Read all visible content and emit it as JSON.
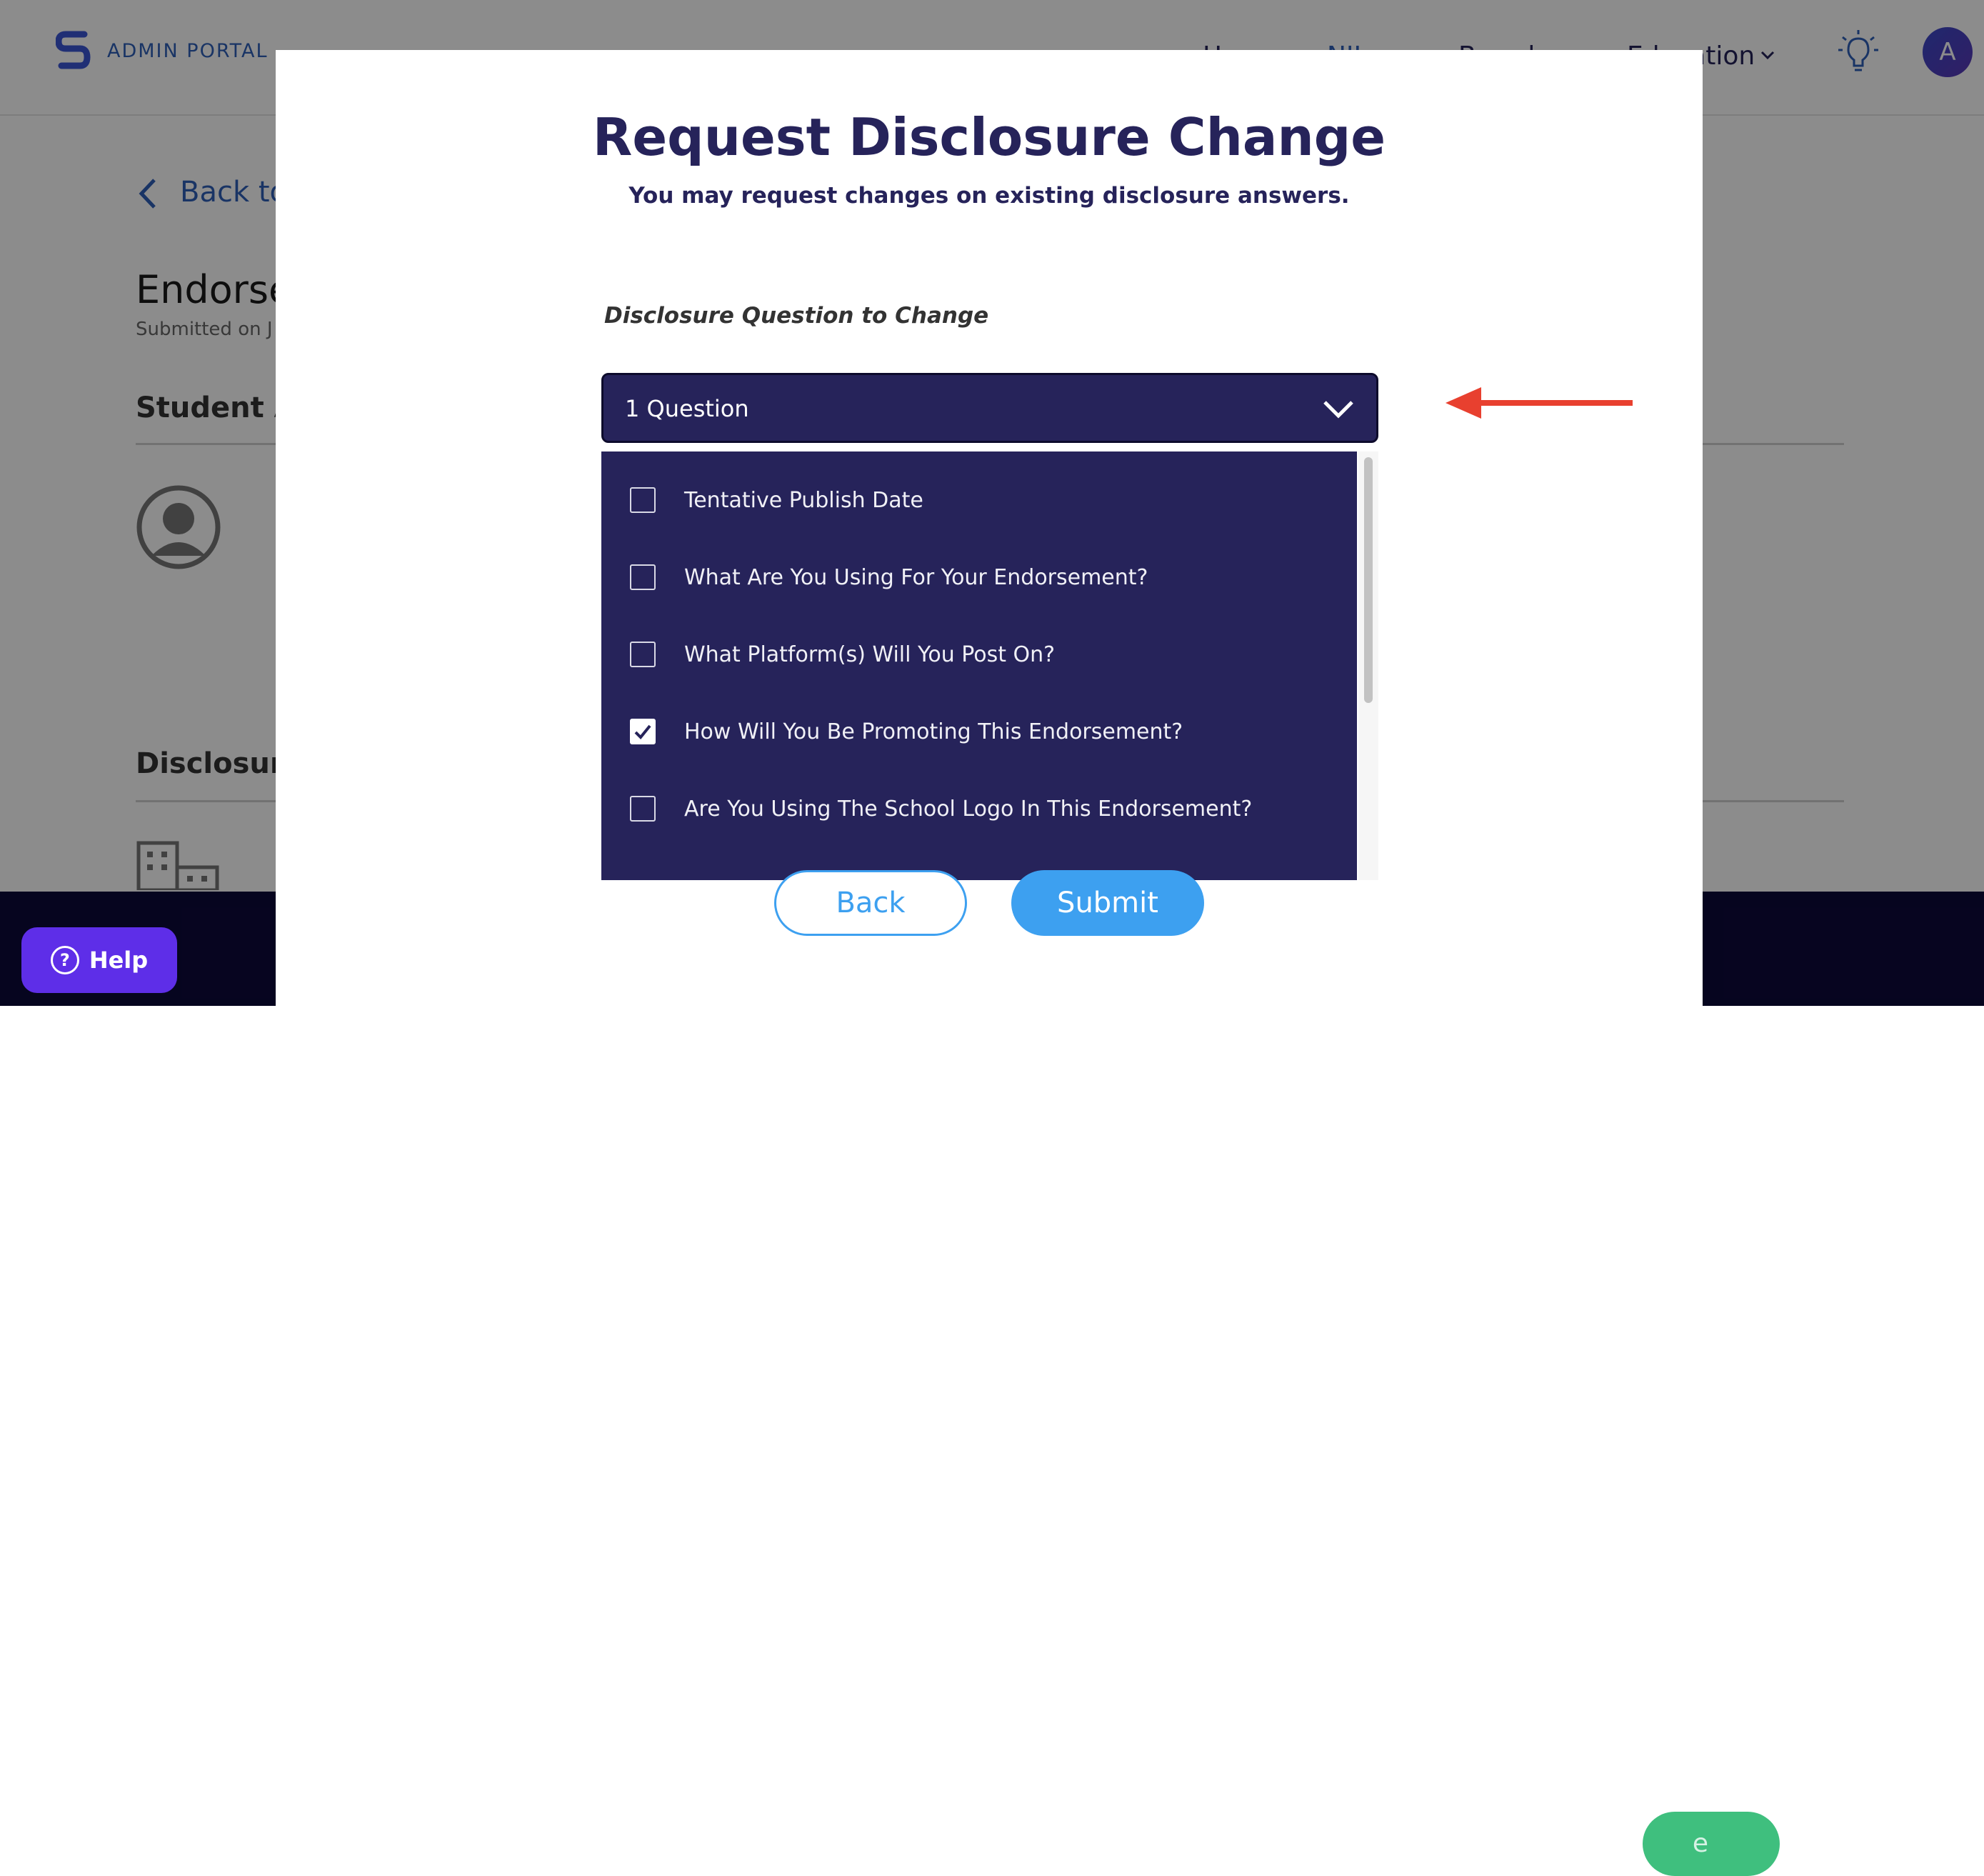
{
  "app": {
    "brand": "ADMIN PORTAL",
    "nav": [
      {
        "label": "Home"
      },
      {
        "label": "NIL"
      },
      {
        "label": "Brands"
      },
      {
        "label": "Education"
      }
    ],
    "avatar_initial": "A"
  },
  "page": {
    "back_label": "Back to",
    "title": "Endorse",
    "submitted": "Submitted on J",
    "section_student": "Student A",
    "section_disclosure": "Disclosure",
    "right_mark": "0"
  },
  "help": {
    "label": "Help",
    "icon": "question-icon"
  },
  "footer": {
    "cta_label": "e",
    "cta_color": "#3fbf7e"
  },
  "modal": {
    "title": "Request Disclosure Change",
    "subtitle": "You may request changes on existing disclosure answers.",
    "field_label": "Disclosure Question to Change",
    "select_value": "1 Question",
    "options": [
      {
        "label": "Tentative Publish Date",
        "checked": false
      },
      {
        "label": "What Are You Using For Your Endorsement?",
        "checked": false
      },
      {
        "label": "What Platform(s) Will You Post On?",
        "checked": false
      },
      {
        "label": "How Will You Be Promoting This Endorsement?",
        "checked": true
      },
      {
        "label": "Are You Using The School Logo In This Endorsement?",
        "checked": false
      }
    ],
    "back_label": "Back",
    "submit_label": "Submit"
  },
  "colors": {
    "primary_dark": "#26235a",
    "accent_blue": "#3da0f0",
    "help_purple": "#5e2ee8",
    "annotation_arrow": "#e8402f"
  }
}
